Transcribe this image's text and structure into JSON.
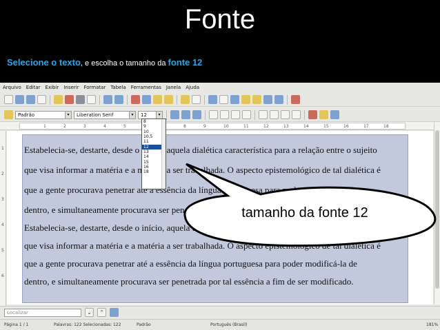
{
  "slide": {
    "title": "Fonte",
    "subtitle_hl1": "Selecione o texto",
    "subtitle_mid": ", e escolha o tamanho da ",
    "subtitle_hl2": "fonte 12",
    "accent_color": "#2ba6e8"
  },
  "menu": [
    "Arquivo",
    "Editar",
    "Exibir",
    "Inserir",
    "Formatar",
    "Tabela",
    "Ferramentas",
    "Janela",
    "Ajuda"
  ],
  "format_bar": {
    "style": "Padrão",
    "font": "Liberation Serif",
    "size": "12"
  },
  "ruler_numbers": [
    "1",
    "2",
    "3",
    "4",
    "5",
    "6",
    "7",
    "8",
    "9",
    "10",
    "11",
    "12",
    "13",
    "14",
    "15",
    "16",
    "17",
    "18"
  ],
  "vruler_numbers": [
    "1",
    "2",
    "3",
    "4",
    "5",
    "6"
  ],
  "size_options": [
    "8",
    "9",
    "10",
    "10,5",
    "11",
    "12",
    "13",
    "14",
    "15",
    "16",
    "18"
  ],
  "size_selected": "12",
  "document_lines": [
    "Estabelecia-se, destarte, desde o início, aquela dialética característica para a relação entre o sujeito",
    "que visa informar a matéria e a matéria a ser trabalhada. O aspecto epistemológico de tal dialética é",
    "que a gente procurava penetrar até a essência da língua portuguesa para poder modificá-la de",
    "dentro, e simultaneamente procurava ser penetrada por tal essência a fim de ser modificado.",
    "Estabelecia-se, destarte, desde o início, aquela dialética característica para a relação entre o sujeito",
    "que visa informar a matéria e a matéria a ser trabalhada. O aspecto epistemológico de tal dialética é",
    "que a gente procurava penetrar até a essência da língua portuguesa para poder modificá-la de",
    "dentro, e simultaneamente procurava ser penetrada por tal essência a fim de ser modificado."
  ],
  "callout_text": "tamanho da fonte 12",
  "find": {
    "placeholder": "Localizar"
  },
  "status": {
    "page": "Página 1 / 1",
    "words": "Palavras: 122 Selecionadas: 122",
    "style": "Padrão",
    "language": "Português (Brasil)",
    "zoom": "181%"
  }
}
